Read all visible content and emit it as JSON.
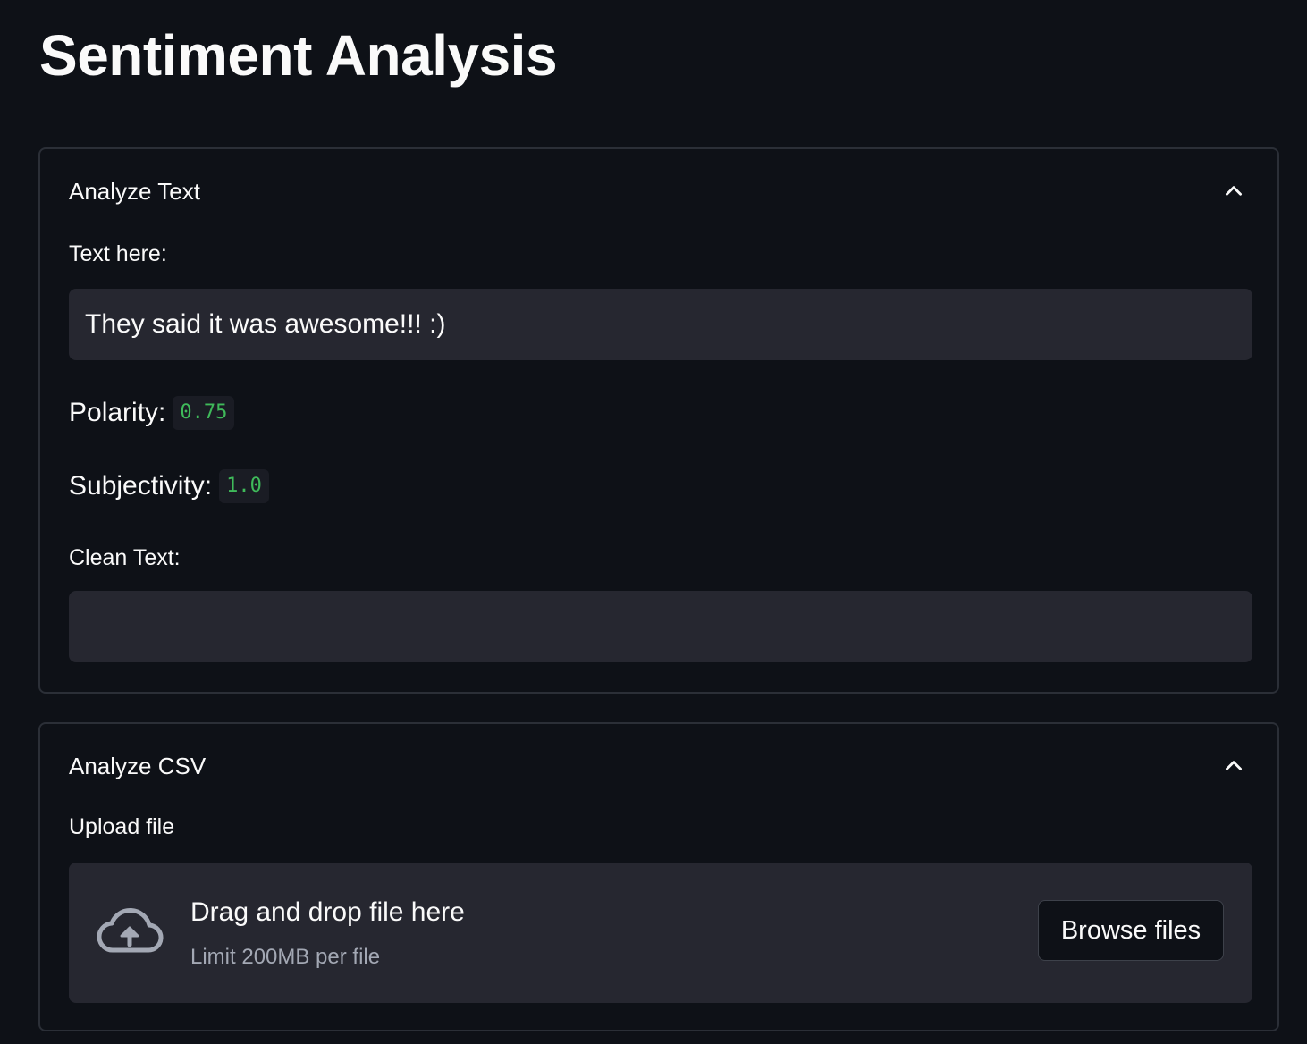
{
  "page": {
    "title": "Sentiment Analysis"
  },
  "analyze_text": {
    "header": "Analyze Text",
    "chevron_icon": "chevron-up-icon",
    "input_label": "Text here:",
    "input_value": "They said it was awesome!!! :)",
    "polarity_label": "Polarity:",
    "polarity_value": "0.75",
    "subjectivity_label": "Subjectivity:",
    "subjectivity_value": "1.0",
    "clean_text_label": "Clean Text:",
    "clean_text_value": ""
  },
  "analyze_csv": {
    "header": "Analyze CSV",
    "chevron_icon": "chevron-up-icon",
    "upload_label": "Upload file",
    "upload_icon": "cloud-upload-icon",
    "dropzone_title": "Drag and drop file here",
    "dropzone_limit": "Limit 200MB per file",
    "browse_label": "Browse files"
  },
  "colors": {
    "background": "#0e1117",
    "input_background": "#262730",
    "border": "#2b2f37",
    "code_value": "#3fba5a",
    "muted_text": "#a3a8b4"
  }
}
